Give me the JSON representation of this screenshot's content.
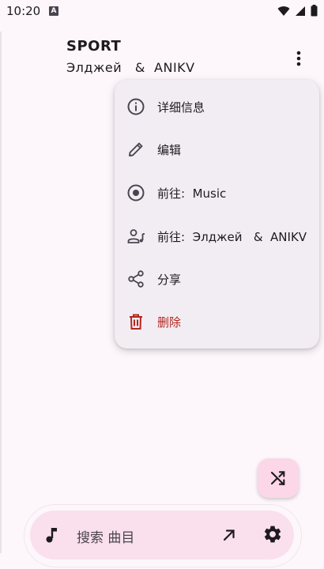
{
  "status_bar": {
    "time": "10:20",
    "app_badge": "A"
  },
  "header": {
    "title": "SPORT",
    "artist": "Элджей   &  ANIKV"
  },
  "menu": {
    "items": [
      {
        "label": "详细信息",
        "icon": "info-icon"
      },
      {
        "label": "编辑",
        "icon": "pencil-icon"
      },
      {
        "label": "前往:  Music",
        "icon": "album-icon"
      },
      {
        "label": "前往:  Элджей   &  ANIKV",
        "icon": "artist-icon"
      },
      {
        "label": "分享",
        "icon": "share-icon"
      },
      {
        "label": "删除",
        "icon": "trash-icon"
      }
    ]
  },
  "search": {
    "placeholder": "搜索 曲目"
  },
  "colors": {
    "background": "#fdf7fb",
    "menu_bg": "#f2edf3",
    "accent_pink": "#fcd7e8",
    "danger": "#b3261e",
    "icon": "#49454f"
  }
}
